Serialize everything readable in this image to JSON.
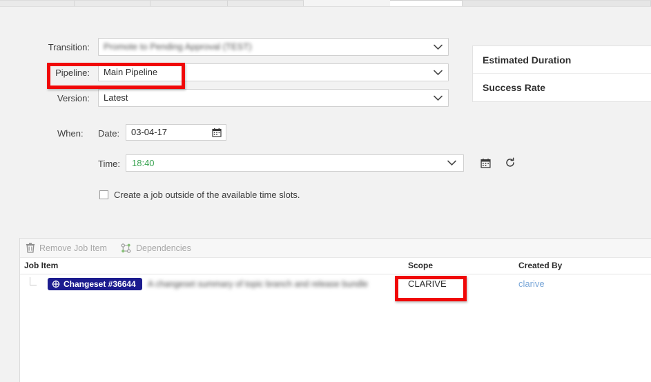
{
  "tabstrip": {
    "tabs": [
      {
        "label": "",
        "active": false
      },
      {
        "label": "",
        "active": false
      },
      {
        "label": "",
        "active": false
      },
      {
        "label": "",
        "active": false
      },
      {
        "label": "",
        "active": true
      },
      {
        "label": "",
        "active": false
      }
    ]
  },
  "form": {
    "transition": {
      "label": "Transition:",
      "value": "Promote to Pending Approval (TEST)",
      "blurred": true
    },
    "pipeline": {
      "label": "Pipeline:",
      "value": "Main Pipeline",
      "blurred": false
    },
    "version": {
      "label": "Version:",
      "value": "Latest",
      "blurred": false
    },
    "when": {
      "label": "When:",
      "date_label": "Date:",
      "date_value": "03-04-17",
      "time_label": "Time:",
      "time_value": "18:40",
      "time_value_color": "#3aa352"
    },
    "checkbox": {
      "label": "Create a job outside of the available time slots.",
      "checked": false
    }
  },
  "stats": {
    "rows": [
      {
        "label": "Estimated Duration",
        "value": ""
      },
      {
        "label": "Success Rate",
        "value": ""
      }
    ]
  },
  "grid": {
    "toolbar": [
      {
        "label": "Remove Job Item",
        "icon": "trash-icon",
        "enabled": false
      },
      {
        "label": "Dependencies",
        "icon": "dependencies-icon",
        "enabled": false
      }
    ],
    "columns": [
      {
        "key": "job_item",
        "label": "Job Item"
      },
      {
        "key": "scope",
        "label": "Scope"
      },
      {
        "key": "created_by",
        "label": "Created By"
      }
    ],
    "rows": [
      {
        "badge": "Changeset #36644",
        "badge_icon": "changeset-icon",
        "badge_color": "#1c1c8f",
        "description": "A changeset summary of topic branch and release bundle",
        "description_blurred": true,
        "scope": "CLARIVE",
        "created_by": "clarive"
      }
    ]
  },
  "annotations": {
    "highlight_color": "#f00808",
    "boxes": [
      {
        "name": "pipeline-highlight",
        "target": "Pipeline: Main Pipeline"
      },
      {
        "name": "scope-highlight",
        "target": "CLARIVE"
      }
    ]
  }
}
